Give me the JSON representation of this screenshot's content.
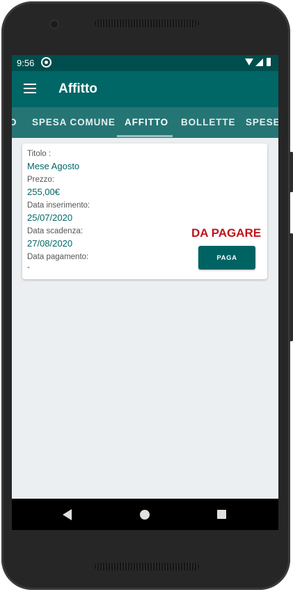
{
  "status_bar": {
    "time": "9:56",
    "icons": [
      "sync-icon",
      "wifi-icon",
      "signal-icon",
      "battery-icon"
    ]
  },
  "app_bar": {
    "title": "Affitto",
    "menu_icon": "hamburger-menu-icon"
  },
  "tabs": [
    {
      "label": "O",
      "active": false
    },
    {
      "label": "SPESA COMUNE",
      "active": false
    },
    {
      "label": "AFFITTO",
      "active": true
    },
    {
      "label": "BOLLETTE",
      "active": false
    },
    {
      "label": "SPESE",
      "active": false
    }
  ],
  "card": {
    "titolo_label": "Titolo :",
    "titolo_value": "Mese Agosto",
    "prezzo_label": "Prezzo:",
    "prezzo_value": "255,00€",
    "inserimento_label": "Data inserimento:",
    "inserimento_value": "25/07/2020",
    "scadenza_label": "Data scadenza:",
    "scadenza_value": "27/08/2020",
    "pagamento_label": "Data pagamento:",
    "pagamento_value": "-",
    "status": "DA PAGARE",
    "pay_button": "PAGA"
  },
  "nav_bar": {
    "icons": [
      "back-icon",
      "home-icon",
      "recents-icon"
    ]
  },
  "colors": {
    "primary": "#006666",
    "status_bar": "#004d4d",
    "tabs": "#267575",
    "alert": "#c0141c",
    "background": "#eceff1"
  }
}
